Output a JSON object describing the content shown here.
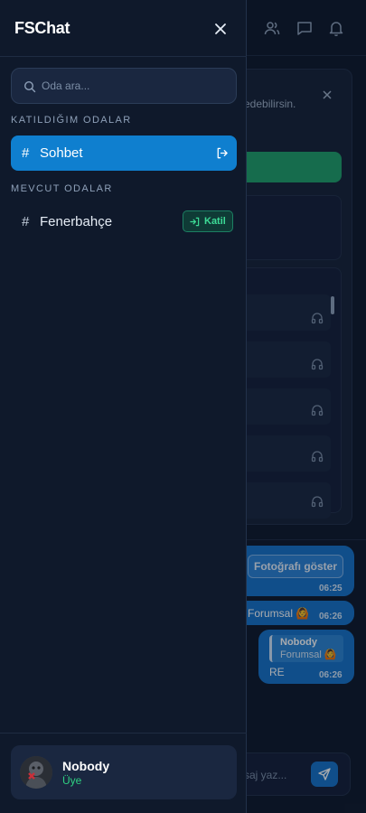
{
  "app": {
    "title": "FSChat"
  },
  "search": {
    "placeholder": "Oda ara..."
  },
  "sections": {
    "joined": "KATILDIĞIM ODALAR",
    "available": "MEVCUT ODALAR"
  },
  "joined_rooms": [
    {
      "hash": "#",
      "name": "Sohbet",
      "active": true
    }
  ],
  "available_rooms": [
    {
      "hash": "#",
      "name": "Fenerbahçe",
      "join_label": "Katil"
    }
  ],
  "user": {
    "name": "Nobody",
    "role": "Üye"
  },
  "background": {
    "card_text": "edebilirsin.",
    "photo_button": "Fotoğrafı göster",
    "messages": [
      {
        "text": "",
        "time": "06:25"
      },
      {
        "text": "Forumsal 🙆",
        "time": "06:26"
      },
      {
        "reply_name": "Nobody",
        "reply_text": "Forumsal 🙆",
        "text": "RE",
        "time": "06:26"
      }
    ],
    "input_placeholder": "saj yaz..."
  },
  "colors": {
    "accent": "#0f7fcf",
    "join_green": "#3ddc97",
    "role_green": "#2fd182",
    "bubble": "#1672c8"
  },
  "icons": [
    "close-icon",
    "users-icon",
    "chat-icon",
    "bell-icon",
    "search-icon",
    "leave-icon",
    "join-icon",
    "send-icon",
    "headset-icon"
  ]
}
